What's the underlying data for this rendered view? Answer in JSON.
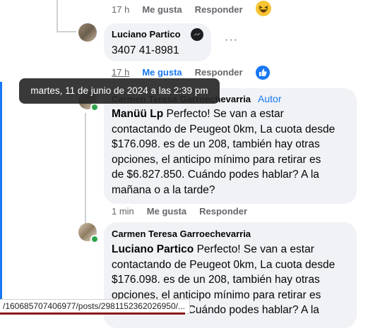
{
  "comment_top": {
    "time": "17 h",
    "like": "Me gusta",
    "reply": "Responder",
    "reaction": "haha"
  },
  "comment_luciano": {
    "author": "Luciano Partico",
    "text": "3407 41-8981",
    "more": "···",
    "time": "17 h",
    "like": "Me gusta",
    "reply": "Responder",
    "reaction": "like"
  },
  "tooltip": {
    "text": "martes, 11 de junio de 2024 a las 2:39 pm"
  },
  "comment_carmen_author": {
    "author": "Carmen Teresa Garroechevarria",
    "badge": "Autor",
    "mention": "Manüü Lp",
    "text_lines": [
      " Perfecto! Se van a estar",
      "contactando de Peugeot 0km, La cuota desde",
      "$176.098. es de un 208, también hay otras",
      "opciones, el anticipo mínimo para retirar es",
      "de $6.827.850. Cuándo podes hablar? A la",
      "mañana o a la tarde?"
    ],
    "time": "1 min",
    "like": "Me gusta",
    "reply": "Responder"
  },
  "comment_carmen_2": {
    "author": "Carmen Teresa Garroechevarria",
    "mention": "Luciano Partico",
    "text_lines": [
      " Perfecto! Se van a estar",
      "contactando de Peugeot 0km, La cuota desde",
      "$176.098. es de un 208, también hay otras",
      "opciones, el anticipo mínimo para retirar es",
      "de $6.827.850. Cuándo podes hablar? A la"
    ]
  },
  "statusbar": {
    "url": "/160685707406977/posts/2981152362026950/..."
  },
  "colors": {
    "accent": "#1877f2",
    "bubble": "#f0f2f5",
    "meta": "#65676b",
    "tooltip_bg": "#282828"
  }
}
